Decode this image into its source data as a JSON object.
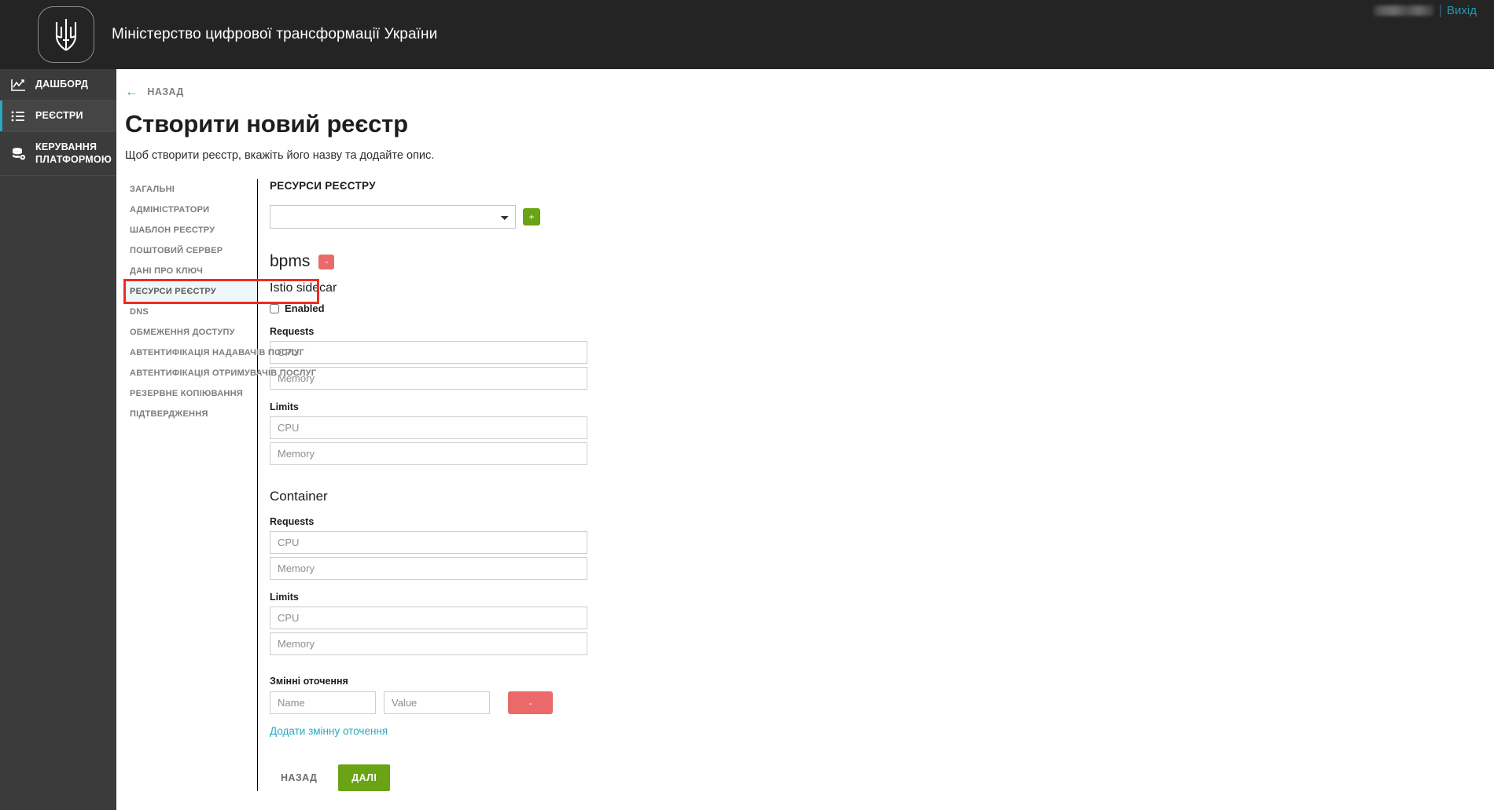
{
  "header": {
    "brand_title": "Міністерство цифрової трансформації України",
    "logo_icon": "ukraine-trident-icon",
    "user_name_redacted": "",
    "logout_label": "Вихід"
  },
  "sidebar": {
    "items": [
      {
        "label": "ДАШБОРД",
        "icon": "chart-icon",
        "active": false
      },
      {
        "label": "РЕЄСТРИ",
        "icon": "list-icon",
        "active": true
      },
      {
        "label": "КЕРУВАННЯ ПЛАТФОРМОЮ",
        "icon": "database-gear-icon",
        "active": false
      }
    ]
  },
  "page": {
    "back_label": "НАЗАД",
    "back_icon": "arrow-left-icon",
    "title": "Створити новий реєстр",
    "subtitle": "Щоб створити реєстр, вкажіть його назву та додайте опис."
  },
  "steps": [
    {
      "label": "ЗАГАЛЬНІ",
      "current": false
    },
    {
      "label": "АДМІНІСТРАТОРИ",
      "current": false
    },
    {
      "label": "ШАБЛОН РЕЄСТРУ",
      "current": false
    },
    {
      "label": "ПОШТОВИЙ СЕРВЕР",
      "current": false
    },
    {
      "label": "ДАНІ ПРО КЛЮЧ",
      "current": false
    },
    {
      "label": "РЕСУРСИ РЕЄСТРУ",
      "current": true
    },
    {
      "label": "DNS",
      "current": false
    },
    {
      "label": "ОБМЕЖЕННЯ ДОСТУПУ",
      "current": false
    },
    {
      "label": "АВТЕНТИФІКАЦІЯ НАДАВАЧІВ ПОСЛУГ",
      "current": false
    },
    {
      "label": "АВТЕНТИФІКАЦІЯ ОТРИМУВАЧІВ ПОСЛУГ",
      "current": false
    },
    {
      "label": "РЕЗЕРВНЕ КОПІЮВАННЯ",
      "current": false
    },
    {
      "label": "ПІДТВЕРДЖЕННЯ",
      "current": false
    }
  ],
  "form": {
    "section_title": "РЕСУРСИ РЕЄСТРУ",
    "resource_select": {
      "value": "",
      "options": [
        ""
      ],
      "chevron_icon": "chevron-down-icon"
    },
    "add_button_label": "+",
    "resource": {
      "name": "bpms",
      "remove_button_label": "-",
      "istio": {
        "title": "Istio sidecar",
        "enabled_label": "Enabled",
        "enabled_checked": false,
        "requests_label": "Requests",
        "requests_cpu_placeholder": "CPU",
        "requests_cpu_value": "",
        "requests_memory_placeholder": "Memory",
        "requests_memory_value": "",
        "limits_label": "Limits",
        "limits_cpu_placeholder": "CPU",
        "limits_cpu_value": "",
        "limits_memory_placeholder": "Memory",
        "limits_memory_value": ""
      },
      "container": {
        "title": "Container",
        "requests_label": "Requests",
        "requests_cpu_placeholder": "CPU",
        "requests_cpu_value": "",
        "requests_memory_placeholder": "Memory",
        "requests_memory_value": "",
        "limits_label": "Limits",
        "limits_cpu_placeholder": "CPU",
        "limits_cpu_value": "",
        "limits_memory_placeholder": "Memory",
        "limits_memory_value": ""
      },
      "env": {
        "title": "Змінні оточення",
        "name_placeholder": "Name",
        "name_value": "",
        "value_placeholder": "Value",
        "value_value": "",
        "remove_button_label": "-",
        "add_link_label": "Додати змінну оточення"
      }
    },
    "footer": {
      "back_label": "НАЗАД",
      "next_label": "ДАЛІ"
    }
  },
  "colors": {
    "accent_teal": "#2aa9c4",
    "primary_green": "#6aa313",
    "danger_red": "#ea6a6a",
    "annotation_red": "#f02b21",
    "header_dark": "#242424",
    "sidebar_dark": "#3b3b3b",
    "step_active_bg": "#eef7fb"
  }
}
